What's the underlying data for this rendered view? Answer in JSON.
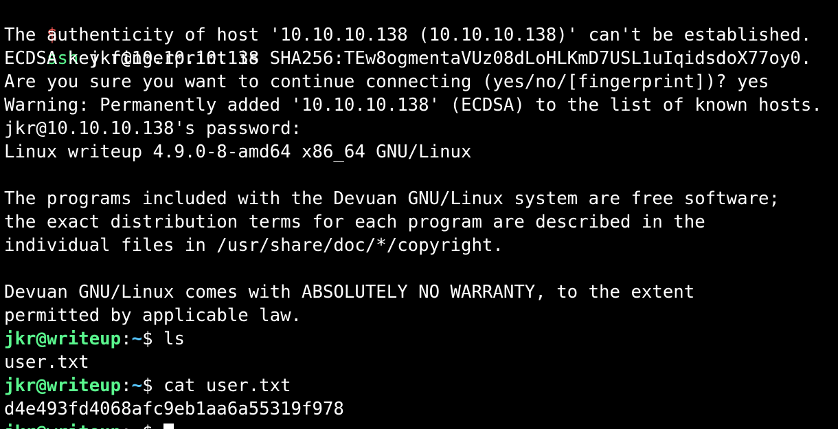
{
  "colors": {
    "background": "#000000",
    "text": "#ffffff",
    "prompt_dollar": "#ff5c57",
    "command_green": "#5af78e",
    "user_host": "#5af78e",
    "path": "#57c7ff"
  },
  "session": {
    "local_prompt": {
      "symbol": "$",
      "command": "ssh",
      "args": " jkr@10.10.10.138"
    },
    "output_1": [
      "The authenticity of host '10.10.10.138 (10.10.10.138)' can't be established.",
      "ECDSA key fingerprint is SHA256:TEw8ogmentaVUz08dLoHLKmD7USL1uIqidsdoX77oy0.",
      "Are you sure you want to continue connecting (yes/no/[fingerprint])? yes",
      "Warning: Permanently added '10.10.10.138' (ECDSA) to the list of known hosts.",
      "jkr@10.10.10.138's password:",
      "Linux writeup 4.9.0-8-amd64 x86_64 GNU/Linux",
      "",
      "The programs included with the Devuan GNU/Linux system are free software;",
      "the exact distribution terms for each program are described in the",
      "individual files in /usr/share/doc/*/copyright.",
      "",
      "Devuan GNU/Linux comes with ABSOLUTELY NO WARRANTY, to the extent",
      "permitted by applicable law."
    ],
    "remote_prompt": {
      "user_host": "jkr@writeup",
      "sep": ":",
      "path": "~",
      "symbol": "$"
    },
    "command_1": " ls",
    "command_1_output": "user.txt",
    "command_2": " cat user.txt",
    "command_2_output": "d4e493fd4068afc9eb1aa6a55319f978",
    "command_3": " "
  }
}
